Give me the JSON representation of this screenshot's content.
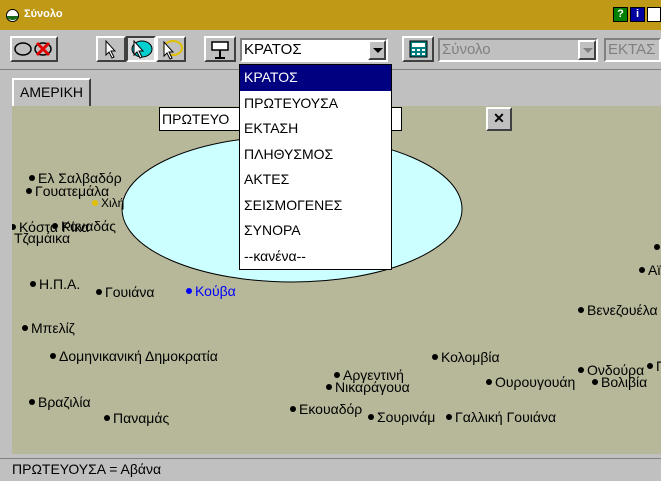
{
  "window": {
    "title": "Σύνολο"
  },
  "titlebar_buttons": {
    "help": "?",
    "info": "i"
  },
  "toolbar": {
    "field_combo": "ΚΡΑΤΟΣ",
    "set_combo": "Σύνολο",
    "right_combo": "ΕΚΤΑΣ"
  },
  "tab": {
    "label": "ΑΜΕΡΙΚΗ"
  },
  "query": {
    "text": "ΠΡΩΤΕΥΟ",
    "close": "✕"
  },
  "dropdown": {
    "items": [
      "ΚΡΑΤΟΣ",
      "ΠΡΩΤΕΥΟΥΣΑ",
      "ΕΚΤΑΣΗ",
      "ΠΛΗΘΥΣΜΟΣ",
      "ΑΚΤΕΣ",
      "ΣΕΙΣΜΟΓΕΝΕΣ",
      "ΣΥΝΟΡΑ",
      "--κανένα--"
    ],
    "selected_index": 0
  },
  "map": {
    "points": [
      "Ελ Σαλβαδόρ",
      "Γουατεμάλα",
      "Χιλή",
      "Κόστα Ρίκα",
      "Καναδάς",
      "Τζαμάικα",
      "Η.Π.Α.",
      "Γουιάνα",
      "Κούβα",
      "Μπελίζ",
      "Δομηνικανική Δημοκρατία",
      "Βραζιλία",
      "Παναμάς",
      "Εκουαδόρ",
      "Αργεντινή",
      "Νικαράγουα",
      "Σουρινάμ",
      "Γαλλική Γουιάνα",
      "Κολομβία",
      "Ουρουγουάη",
      "Βολιβία",
      "Ονδούρα",
      "Βενεζουέλα",
      "Αϊτή",
      "Π"
    ],
    "selected": "Κούβα"
  },
  "status": {
    "text": "ΠΡΩΤΕΥΟΥΣΑ = Αβάνα"
  },
  "colors": {
    "titlebar": "#c09a16",
    "map_bg": "#b7b79a",
    "ellipse": "#ccffff",
    "selection": "#000080"
  }
}
